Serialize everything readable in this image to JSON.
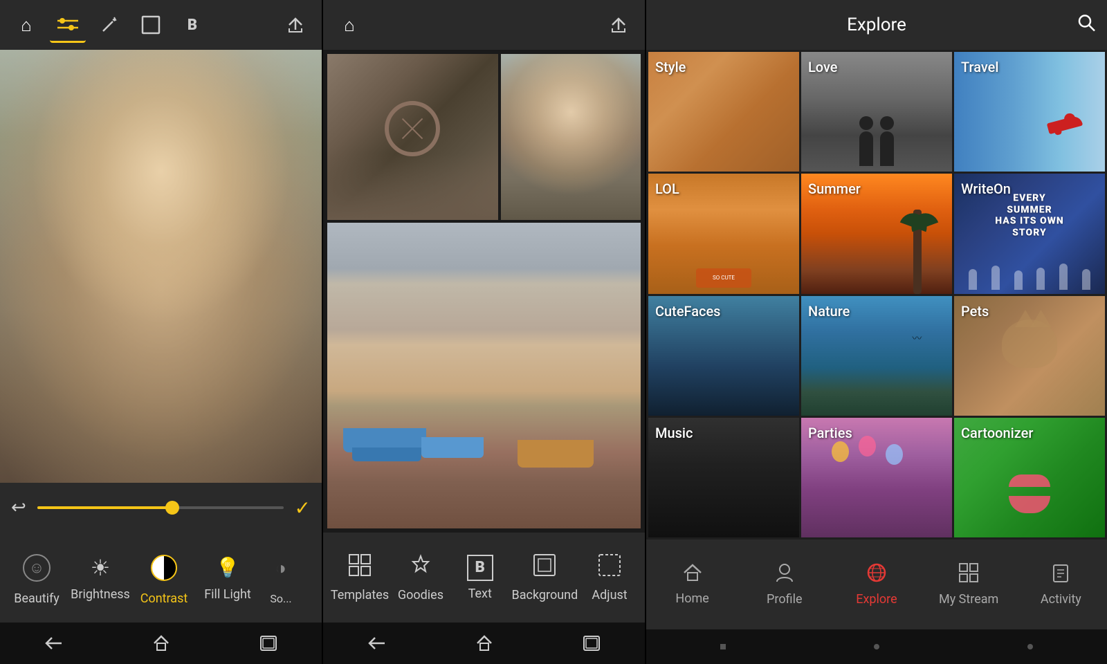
{
  "panel1": {
    "topbar": {
      "icons": [
        {
          "name": "home-icon",
          "symbol": "⌂",
          "active": false
        },
        {
          "name": "sliders-icon",
          "symbol": "⚙",
          "active": true
        },
        {
          "name": "wand-icon",
          "symbol": "✦",
          "active": false
        },
        {
          "name": "frame-icon",
          "symbol": "▭",
          "active": false
        },
        {
          "name": "bold-icon",
          "symbol": "B",
          "active": false
        },
        {
          "name": "share-icon",
          "symbol": "↗",
          "active": false
        }
      ]
    },
    "tools": [
      {
        "id": "beautify",
        "label": "Beautify",
        "active": false
      },
      {
        "id": "brightness",
        "label": "Brightness",
        "active": false
      },
      {
        "id": "contrast",
        "label": "Contrast",
        "active": true
      },
      {
        "id": "filllight",
        "label": "Fill Light",
        "active": false
      },
      {
        "id": "shadow",
        "label": "So...",
        "active": false
      }
    ],
    "slider": {
      "value": 55
    }
  },
  "panel2": {
    "bottomnav": [
      {
        "id": "templates",
        "label": "Templates",
        "symbol": "▦"
      },
      {
        "id": "goodies",
        "label": "Goodies",
        "symbol": "◈"
      },
      {
        "id": "text",
        "label": "Text",
        "symbol": "B"
      },
      {
        "id": "background",
        "label": "Background",
        "symbol": "▣"
      },
      {
        "id": "adjust",
        "label": "Adjust",
        "symbol": "⬚"
      }
    ]
  },
  "panel3": {
    "header": {
      "title": "Explore"
    },
    "categories": [
      {
        "id": "style",
        "label": "Style",
        "bg": "bg-style"
      },
      {
        "id": "love",
        "label": "Love",
        "bg": "bg-love"
      },
      {
        "id": "travel",
        "label": "Travel",
        "bg": "bg-travel"
      },
      {
        "id": "lol",
        "label": "LOL",
        "bg": "bg-lol"
      },
      {
        "id": "summer",
        "label": "Summer",
        "bg": "bg-summer"
      },
      {
        "id": "writeon",
        "label": "WriteOn",
        "bg": "bg-writeon"
      },
      {
        "id": "cutefaces",
        "label": "CuteFaces",
        "bg": "bg-cutefaces"
      },
      {
        "id": "nature",
        "label": "Nature",
        "bg": "bg-nature"
      },
      {
        "id": "pets",
        "label": "Pets",
        "bg": "bg-pets"
      },
      {
        "id": "music",
        "label": "Music",
        "bg": "bg-music"
      },
      {
        "id": "parties",
        "label": "Parties",
        "bg": "bg-parties"
      },
      {
        "id": "cartoonizer",
        "label": "Cartoonizer",
        "bg": "bg-cartoonizer"
      }
    ],
    "writeonText": "EVERY SUMMER\nHAS ITS OWN\nSTORY",
    "bottomnav": [
      {
        "id": "home",
        "label": "Home",
        "symbol": "⌂",
        "active": false
      },
      {
        "id": "profile",
        "label": "Profile",
        "symbol": "👤",
        "active": false
      },
      {
        "id": "explore",
        "label": "Explore",
        "symbol": "🌐",
        "active": true
      },
      {
        "id": "mystream",
        "label": "My Stream",
        "symbol": "⊞",
        "active": false
      },
      {
        "id": "activity",
        "label": "Activity",
        "symbol": "≡",
        "active": false
      }
    ]
  }
}
